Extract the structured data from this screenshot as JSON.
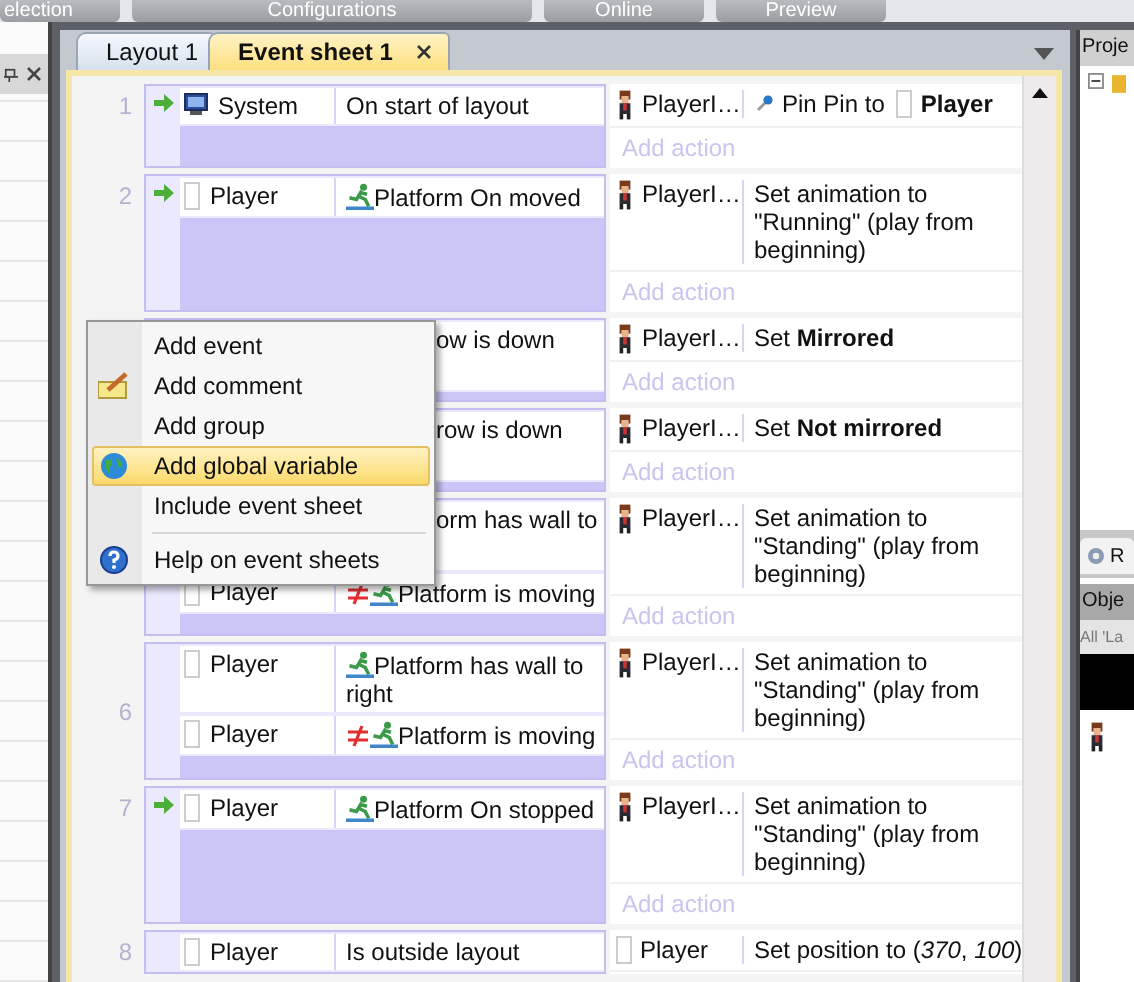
{
  "ribbon_tabs": [
    {
      "label": "election"
    },
    {
      "label": "Configurations"
    },
    {
      "label": "Online"
    },
    {
      "label": "Preview"
    }
  ],
  "document_tabs": [
    {
      "label": "Layout 1",
      "selected": false,
      "closable": false
    },
    {
      "label": "Event sheet 1",
      "selected": true,
      "closable": true
    }
  ],
  "events": [
    {
      "number": "1",
      "trigger": true,
      "conditions": [
        {
          "kind": "system",
          "object": "System",
          "text": "On start of layout",
          "inverted": false,
          "behavior": false,
          "covered": false
        }
      ],
      "actions": [
        {
          "kind": "sprite",
          "object": "PlayerI…",
          "text": "Pin Pin to",
          "target": "Player"
        }
      ],
      "add_action": "Add action"
    },
    {
      "number": "2",
      "trigger": true,
      "conditions": [
        {
          "kind": "object",
          "object": "Player",
          "text": "Platform On moved",
          "inverted": false,
          "behavior": true,
          "covered": false
        }
      ],
      "actions": [
        {
          "kind": "sprite",
          "object": "PlayerI…",
          "text": "Set animation to \"Running\" (play from beginning)"
        }
      ],
      "add_action": "Add action"
    },
    {
      "trigger": false,
      "conditions": [
        {
          "text": "ow is down",
          "inverted": false,
          "behavior": false,
          "covered": true
        }
      ],
      "actions": [
        {
          "kind": "sprite",
          "object": "PlayerI…",
          "text": "Set **Mirrored**"
        }
      ],
      "add_action": "Add action"
    },
    {
      "trigger": false,
      "conditions": [
        {
          "text": "row is down",
          "inverted": false,
          "behavior": false,
          "covered": true
        }
      ],
      "actions": [
        {
          "kind": "sprite",
          "object": "PlayerI…",
          "text": "Set **Not mirrored**"
        }
      ],
      "add_action": "Add action"
    },
    {
      "trigger": false,
      "conditions": [
        {
          "text": "orm has wall to",
          "inverted": false,
          "behavior": false,
          "covered": true
        },
        {
          "kind": "object",
          "object": "Player",
          "text": "Platform is moving",
          "inverted": true,
          "behavior": true,
          "covered": false
        }
      ],
      "actions": [
        {
          "kind": "sprite",
          "object": "PlayerI…",
          "text": "Set animation to \"Standing\" (play from beginning)"
        }
      ],
      "add_action": "Add action"
    },
    {
      "number": "6",
      "trigger": false,
      "conditions": [
        {
          "kind": "object",
          "object": "Player",
          "text": "Platform has wall to right",
          "inverted": false,
          "behavior": true,
          "covered": false
        },
        {
          "kind": "object",
          "object": "Player",
          "text": "Platform is moving",
          "inverted": true,
          "behavior": true,
          "covered": false
        }
      ],
      "actions": [
        {
          "kind": "sprite",
          "object": "PlayerI…",
          "text": "Set animation to \"Standing\" (play from beginning)"
        }
      ],
      "add_action": "Add action"
    },
    {
      "number": "7",
      "trigger": true,
      "conditions": [
        {
          "kind": "object",
          "object": "Player",
          "text": "Platform On stopped",
          "inverted": false,
          "behavior": true,
          "covered": false
        }
      ],
      "actions": [
        {
          "kind": "sprite",
          "object": "PlayerI…",
          "text": "Set animation to \"Standing\" (play from beginning)"
        }
      ],
      "add_action": "Add action"
    },
    {
      "number": "8",
      "trigger": false,
      "conditions": [
        {
          "kind": "object",
          "object": "Player",
          "text": "Is outside layout",
          "inverted": false,
          "behavior": false,
          "covered": false
        }
      ],
      "actions": [
        {
          "kind": "object",
          "object": "Player",
          "text": "Set position to (*370*, *100*)"
        }
      ]
    }
  ],
  "context_menu": [
    {
      "kind": "item",
      "label": "Add event",
      "selected": false
    },
    {
      "kind": "item",
      "label": "Add comment",
      "selected": false
    },
    {
      "kind": "item",
      "label": "Add group",
      "selected": false
    },
    {
      "kind": "item",
      "label": "Add global variable",
      "selected": true
    },
    {
      "kind": "item",
      "label": "Include event sheet",
      "selected": false
    },
    {
      "kind": "separator"
    },
    {
      "kind": "item",
      "label": "Help on event sheets",
      "selected": false
    }
  ],
  "project_panel": {
    "title": "Proje"
  },
  "objects_panel": {
    "tab": "R",
    "title": "Obje",
    "filter": "All 'La"
  }
}
